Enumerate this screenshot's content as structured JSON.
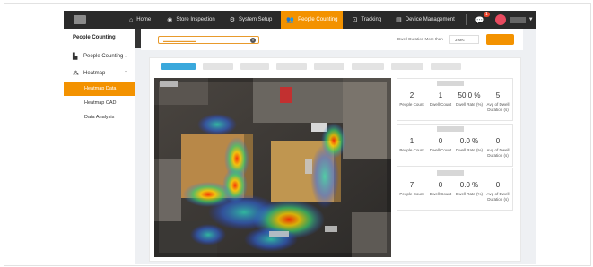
{
  "nav": {
    "items": [
      {
        "label": "Home",
        "icon": "home-icon"
      },
      {
        "label": "Store Inspection",
        "icon": "camera-icon"
      },
      {
        "label": "System Setup",
        "icon": "gear-icon"
      },
      {
        "label": "People Counting",
        "icon": "people-icon",
        "active": true
      },
      {
        "label": "Tracking",
        "icon": "tracking-icon"
      },
      {
        "label": "Device Management",
        "icon": "device-icon"
      }
    ],
    "notification_count": "1"
  },
  "sidebar": {
    "title": "People Counting",
    "groups": [
      {
        "label": "People Counting",
        "icon": "bar-chart-icon"
      },
      {
        "label": "Heatmap",
        "icon": "heatmap-icon"
      }
    ],
    "subitems": [
      {
        "label": "Heatmap Data",
        "active": true
      },
      {
        "label": "Heatmap CAD"
      },
      {
        "label": "Data Analysis"
      }
    ]
  },
  "filter": {
    "dwell_label": "Dwell Duration More than",
    "dwell_value": "3 sec"
  },
  "cards": [
    {
      "people_count": "2",
      "dwell_count": "1",
      "dwell_rate": "50.0 %",
      "avg_dwell": "5"
    },
    {
      "people_count": "1",
      "dwell_count": "0",
      "dwell_rate": "0.0 %",
      "avg_dwell": "0"
    },
    {
      "people_count": "7",
      "dwell_count": "0",
      "dwell_rate": "0.0 %",
      "avg_dwell": "0"
    }
  ],
  "labels": {
    "people_count": "People Count",
    "dwell_count": "Dwell Count",
    "dwell_rate": "Dwell Rate (%)",
    "avg_dwell": "Avg of Dwell Duration (s)"
  },
  "colors": {
    "accent": "#f39200",
    "tab_active": "#3aa8dc",
    "topbar": "#2a2a2a"
  }
}
